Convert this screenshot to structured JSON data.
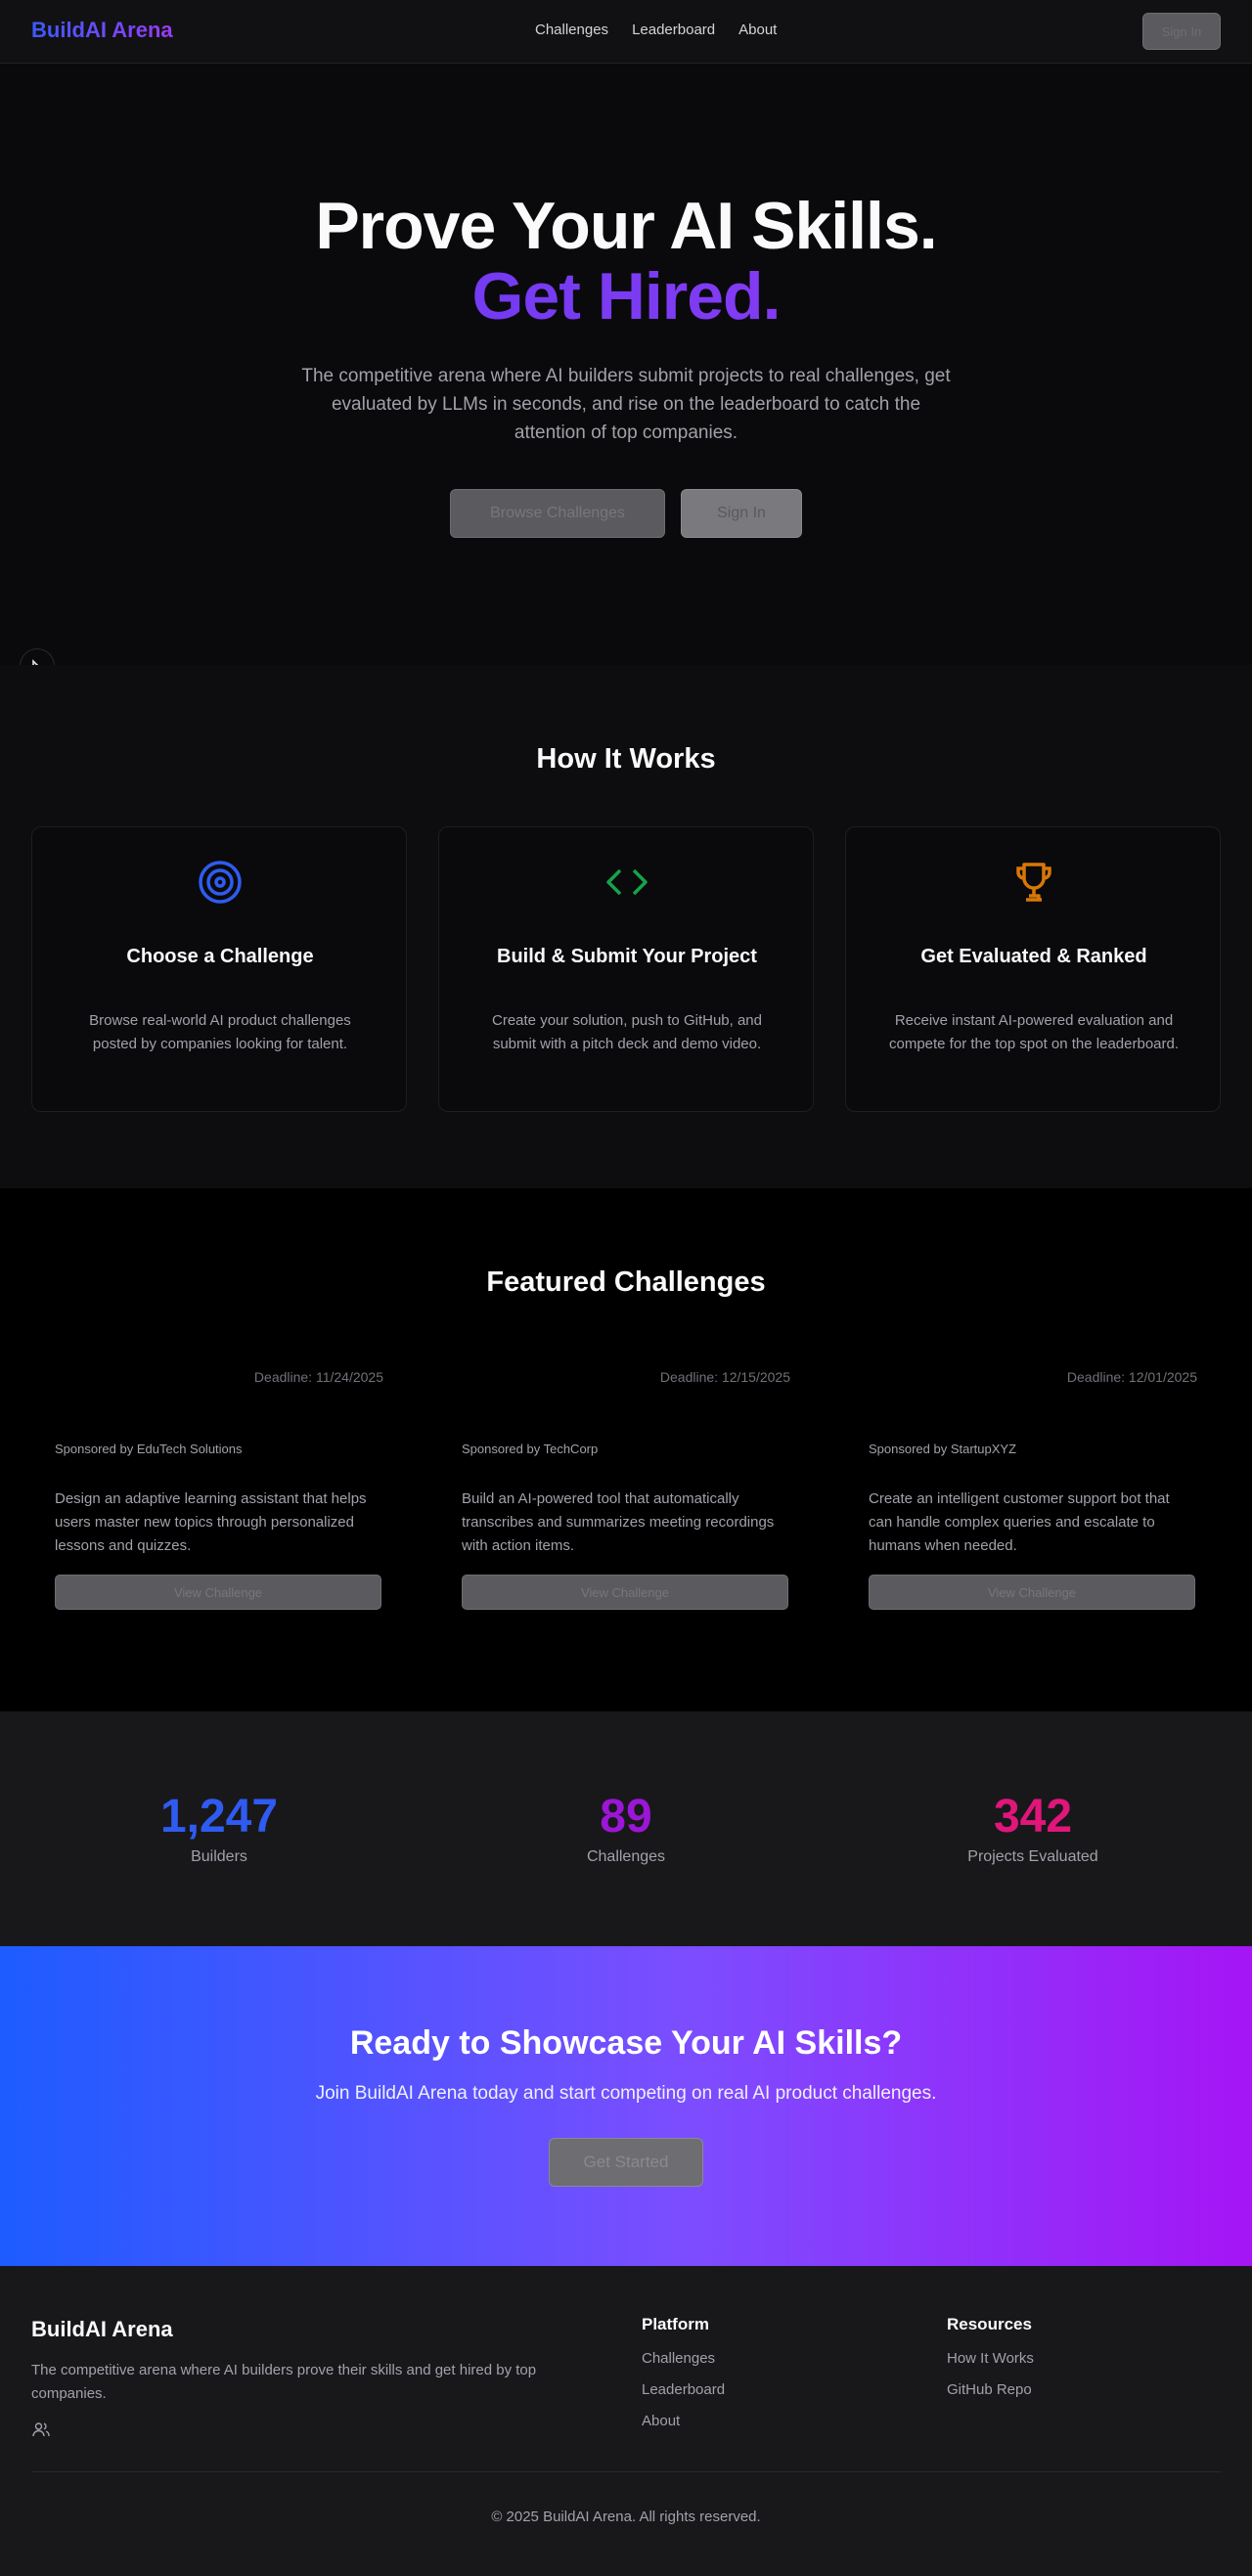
{
  "nav": {
    "logo": "BuildAI Arena",
    "links": [
      "Challenges",
      "Leaderboard",
      "About"
    ],
    "signin": "Sign In"
  },
  "hero": {
    "title_line1": "Prove Your AI Skills.",
    "title_line2": "Get Hired.",
    "subtitle": "The competitive arena where AI builders submit projects to real challenges, get evaluated by LLMs in seconds, and rise on the leaderboard to catch the attention of top companies.",
    "browse_button": "Browse Challenges",
    "signin_button": "Sign In"
  },
  "how": {
    "title": "How It Works",
    "cards": [
      {
        "icon": "target-icon",
        "title": "Choose a Challenge",
        "text": "Browse real-world AI product challenges posted by companies looking for talent.",
        "color": "#2f5bf0"
      },
      {
        "icon": "code-icon",
        "title": "Build & Submit Your Project",
        "text": "Create your solution, push to GitHub, and submit with a pitch deck and demo video.",
        "color": "#16a34a"
      },
      {
        "icon": "trophy-icon",
        "title": "Get Evaluated & Ranked",
        "text": "Receive instant AI-powered evaluation and compete for the top spot on the leaderboard.",
        "color": "#d97706"
      }
    ]
  },
  "featured": {
    "title": "Featured Challenges",
    "challenges": [
      {
        "deadline": "Deadline: 11/24/2025",
        "sponsor": "Sponsored by EduTech Solutions",
        "desc": "Design an adaptive learning assistant that helps users master new topics through personalized lessons and quizzes.",
        "button": "View Challenge"
      },
      {
        "deadline": "Deadline: 12/15/2025",
        "sponsor": "Sponsored by TechCorp",
        "desc": "Build an AI-powered tool that automatically transcribes and summarizes meeting recordings with action items.",
        "button": "View Challenge"
      },
      {
        "deadline": "Deadline: 12/01/2025",
        "sponsor": "Sponsored by StartupXYZ",
        "desc": "Create an intelligent customer support bot that can handle complex queries and escalate to humans when needed.",
        "button": "View Challenge"
      }
    ]
  },
  "stats": [
    {
      "value": "1,247",
      "label": "Builders",
      "color": "#2f5bf0"
    },
    {
      "value": "89",
      "label": "Challenges",
      "color": "#9b16d6"
    },
    {
      "value": "342",
      "label": "Projects Evaluated",
      "color": "#e0167a"
    }
  ],
  "cta": {
    "title": "Ready to Showcase Your AI Skills?",
    "subtitle": "Join BuildAI Arena today and start competing on real AI product challenges.",
    "button": "Get Started"
  },
  "footer": {
    "brand": "BuildAI Arena",
    "tagline": "The competitive arena where AI builders prove their skills and get hired by top companies.",
    "platform": {
      "title": "Platform",
      "links": [
        "Challenges",
        "Leaderboard",
        "About"
      ]
    },
    "resources": {
      "title": "Resources",
      "links": [
        "How It Works",
        "GitHub Repo"
      ]
    },
    "copyright": "© 2025 BuildAI Arena. All rights reserved."
  }
}
